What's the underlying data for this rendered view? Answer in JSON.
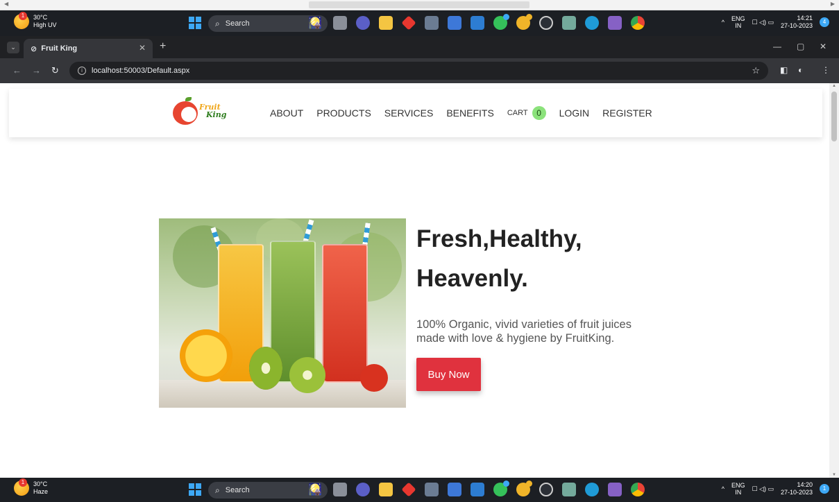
{
  "top_taskbar": {
    "weather_temp": "30°C",
    "weather_desc": "High UV",
    "weather_badge": "1",
    "search_label": "Search",
    "lang_top": "ENG",
    "lang_bottom": "IN",
    "time": "14:21",
    "date": "27-10-2023",
    "notif_count": "4"
  },
  "bottom_taskbar": {
    "weather_temp": "30°C",
    "weather_desc": "Haze",
    "weather_badge": "1",
    "search_label": "Search",
    "lang_top": "ENG",
    "lang_bottom": "IN",
    "time": "14:20",
    "date": "27-10-2023",
    "notif_count": "1"
  },
  "browser": {
    "tab_title": "Fruit King",
    "url": "localhost:50003/Default.aspx"
  },
  "site": {
    "logo_line1": "Fruit",
    "logo_line2": "King",
    "nav": {
      "about": "ABOUT",
      "products": "PRODUCTS",
      "services": "SERVICES",
      "benefits": "BENEFITS",
      "cart": "CART",
      "cart_count": "0",
      "login": "LOGIN",
      "register": "REGISTER"
    },
    "hero": {
      "title_line1": "Fresh,Healthy,",
      "title_line2": "Heavenly.",
      "desc_line1": "100% Organic, vivid varieties of fruit juices",
      "desc_line2": "made with love & hygiene by FruitKing.",
      "cta": "Buy Now"
    }
  },
  "colors": {
    "cta": "#e0323e",
    "cart_badge": "#8be27b",
    "taskbar": "#1c1f24",
    "browser_chrome": "#35363a"
  }
}
